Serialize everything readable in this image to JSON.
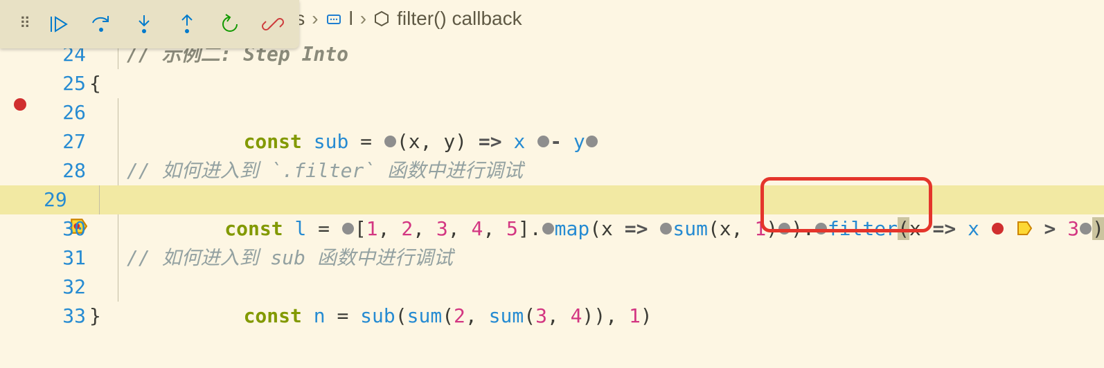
{
  "toolbar": {
    "continue": "Continue",
    "step_over": "Step Over",
    "step_into": "Step Into",
    "step_out": "Step Out",
    "restart": "Restart",
    "stop": "Stop"
  },
  "breadcrumb": {
    "file_suffix": "js",
    "scope": "l",
    "callback": "filter() callback"
  },
  "code": {
    "l24": {
      "num": "24",
      "cmt": "// 示例二: Step Into"
    },
    "l25": {
      "num": "25",
      "brace": "{"
    },
    "l26": {
      "num": "26",
      "kw": "const",
      "name": "sub",
      "eq": " = ",
      "args": "(x, y)",
      "arrow": " => ",
      "a": "x",
      "op": "- ",
      "b": "y"
    },
    "l27": {
      "num": "27"
    },
    "l28": {
      "num": "28",
      "cmt": "// 如何进入到 `.filter` 函数中进行调试"
    },
    "l29": {
      "num": "29",
      "kw": "const",
      "name": "l",
      "eq": " = ",
      "arr_open": "[",
      "n1": "1",
      "n2": "2",
      "n3": "3",
      "n4": "4",
      "n5": "5",
      "arr_close": "]",
      "map": "map",
      "map_args_open": "(x",
      "arrow1": " => ",
      "sum": "sum",
      "sum_args": "(x, ",
      "one": "1",
      "sum_close": ")",
      "map_close": ")",
      "filter": "filter",
      "filter_open": "(",
      "fx": "x",
      "arrow2": " =>",
      "cmp_x": "x",
      "gt": " > ",
      "three": "3",
      "filter_close": ")"
    },
    "l30": {
      "num": "30"
    },
    "l31": {
      "num": "31",
      "cmt": "// 如何进入到 sub 函数中进行调试"
    },
    "l32": {
      "num": "32",
      "kw": "const",
      "name": "n",
      "eq": " = ",
      "sub": "sub",
      "open": "(",
      "sum1": "sum",
      "sum1_open": "(",
      "two": "2",
      "comma1": ", ",
      "sum2": "sum",
      "sum2_open": "(",
      "three": "3",
      "comma2": ", ",
      "four": "4",
      "sum2_close": ")",
      "sum1_close": ")",
      "comma3": ", ",
      "one": "1",
      "close": ")"
    },
    "l33": {
      "num": "33",
      "brace": "}"
    }
  }
}
